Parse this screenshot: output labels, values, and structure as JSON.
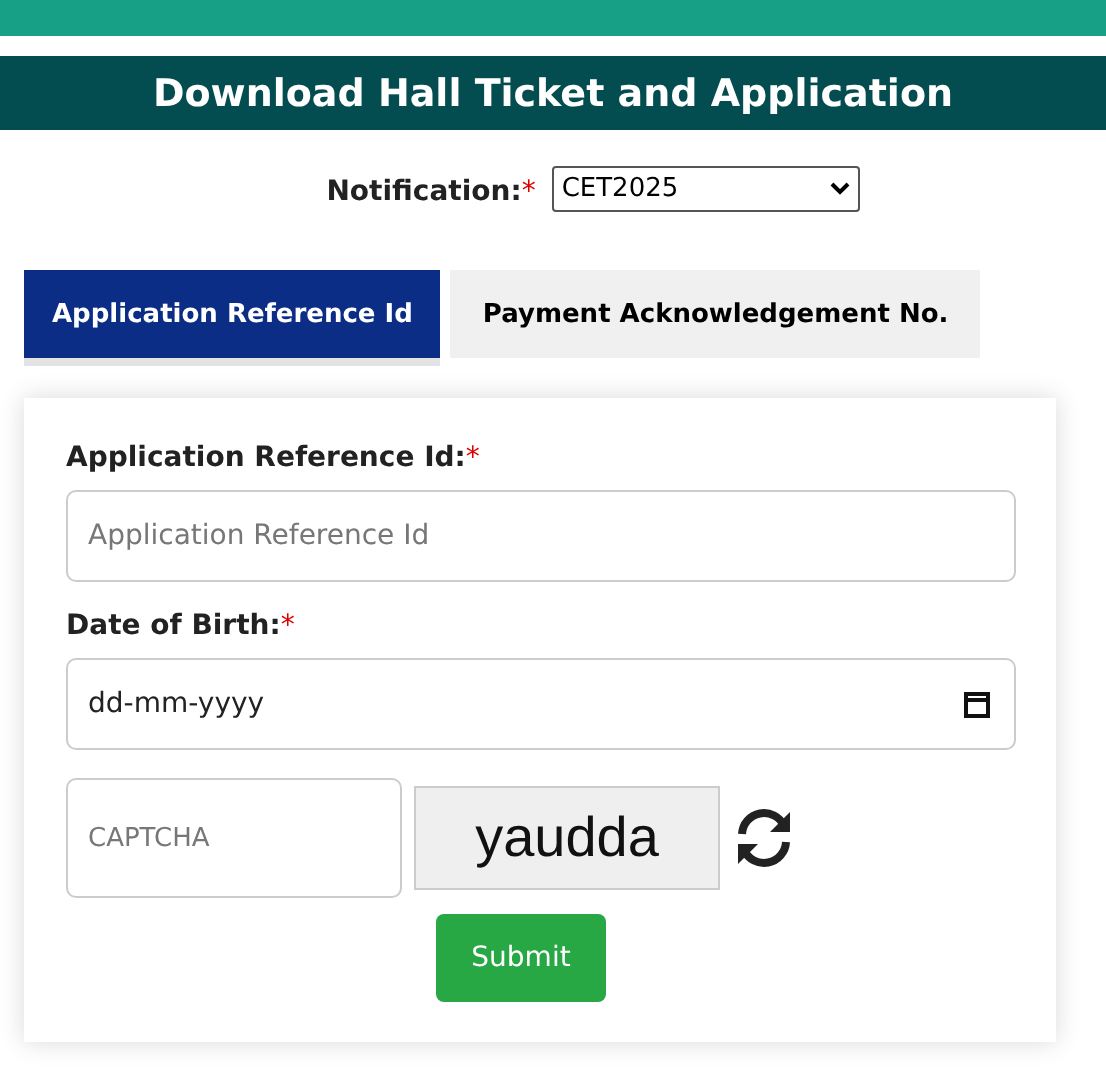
{
  "header": {
    "title": "Download Hall Ticket and Application"
  },
  "notification": {
    "label": "Notification:",
    "required_mark": "*",
    "value": "CET2025"
  },
  "tabs": [
    {
      "label": "Application Reference Id",
      "selected": true
    },
    {
      "label": "Payment Acknowledgement No.",
      "selected": false
    }
  ],
  "form": {
    "fields": [
      {
        "kind": "text",
        "label": "Application Reference Id:",
        "required_mark": "*",
        "placeholder": "Application Reference Id"
      },
      {
        "kind": "date",
        "label": "Date of Birth:",
        "required_mark": "*",
        "value": "dd-mm-yyyy"
      }
    ],
    "captcha": {
      "placeholder": "CAPTCHA",
      "code": "yaudda"
    },
    "submit": "Submit"
  }
}
